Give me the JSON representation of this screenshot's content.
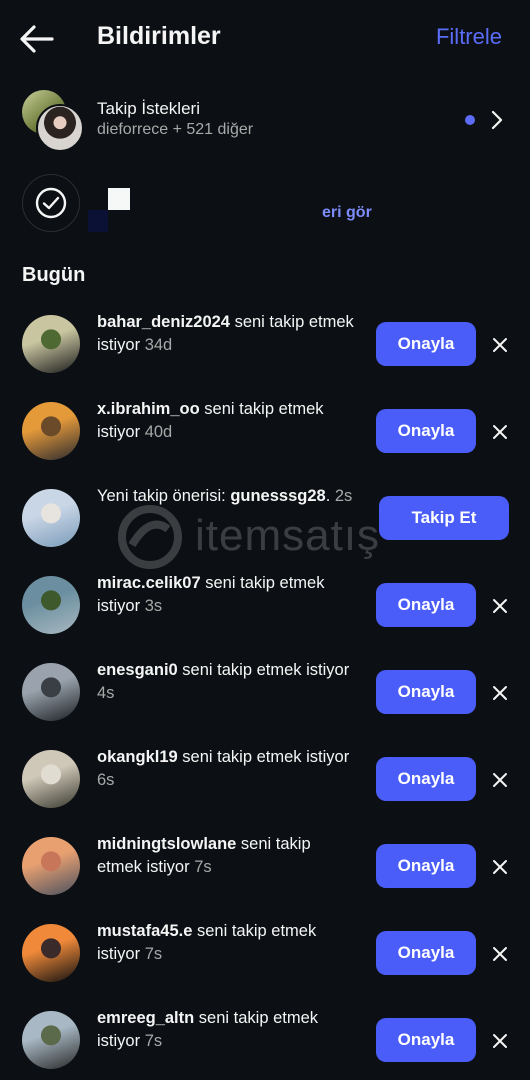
{
  "header": {
    "title": "Bildirimler",
    "filter_label": "Filtrele"
  },
  "follow_requests": {
    "title": "Takip İstekleri",
    "subtitle": "dieforrece + 521 diğer"
  },
  "suggestions": {
    "see_all_label": "eri gör"
  },
  "section_title": "Bugün",
  "watermark": {
    "text": "itemsatış"
  },
  "notifications": [
    {
      "username": "bahar_deniz2024",
      "message": " seni takip etmek istiyor",
      "time": "34d",
      "action": "Onayla",
      "colors": [
        "#c8c5a0",
        "#4e6a32",
        "#1c1c1c"
      ]
    },
    {
      "username": "x.ibrahim_oo",
      "message": " seni takip etmek istiyor",
      "time": "40d",
      "action": "Onayla",
      "colors": [
        "#e59a3a",
        "#6b4a2a",
        "#2b2a2f"
      ]
    },
    {
      "prefix": "Yeni takip önerisi: ",
      "username": "gunesssg28",
      "suffix": ".",
      "time": "2s",
      "action": "Takip Et",
      "colors": [
        "#c9d6e6",
        "#e7e3de",
        "#7b9bb9"
      ]
    },
    {
      "username": "mirac.celik07",
      "message": " seni takip etmek istiyor",
      "time": "3s",
      "action": "Onayla",
      "colors": [
        "#6b8fa0",
        "#3e5a2c",
        "#a8b8c0"
      ]
    },
    {
      "username": "enesgani0",
      "message": " seni takip etmek istiyor",
      "time": "4s",
      "action": "Onayla",
      "colors": [
        "#9aa3ad",
        "#3a3f45",
        "#1c2024"
      ]
    },
    {
      "username": "okangkl19",
      "message": " seni takip etmek istiyor",
      "time": "6s",
      "action": "Onayla",
      "colors": [
        "#cfc8b8",
        "#e0dcd2",
        "#3a3a30"
      ]
    },
    {
      "username": "midningtslowlane",
      "message": " seni takip etmek istiyor",
      "time": "7s",
      "action": "Onayla",
      "colors": [
        "#e8a070",
        "#c8765a",
        "#4a5060"
      ]
    },
    {
      "username": "mustafa45.e",
      "message": " seni takip etmek istiyor",
      "time": "7s",
      "action": "Onayla",
      "colors": [
        "#f08a3a",
        "#3a2a2a",
        "#101010"
      ]
    },
    {
      "username": "emreeg_altn",
      "message": " seni takip etmek istiyor",
      "time": "7s",
      "action": "Onayla",
      "colors": [
        "#a8b8c4",
        "#5a6a4a",
        "#2a2a2a"
      ]
    }
  ]
}
